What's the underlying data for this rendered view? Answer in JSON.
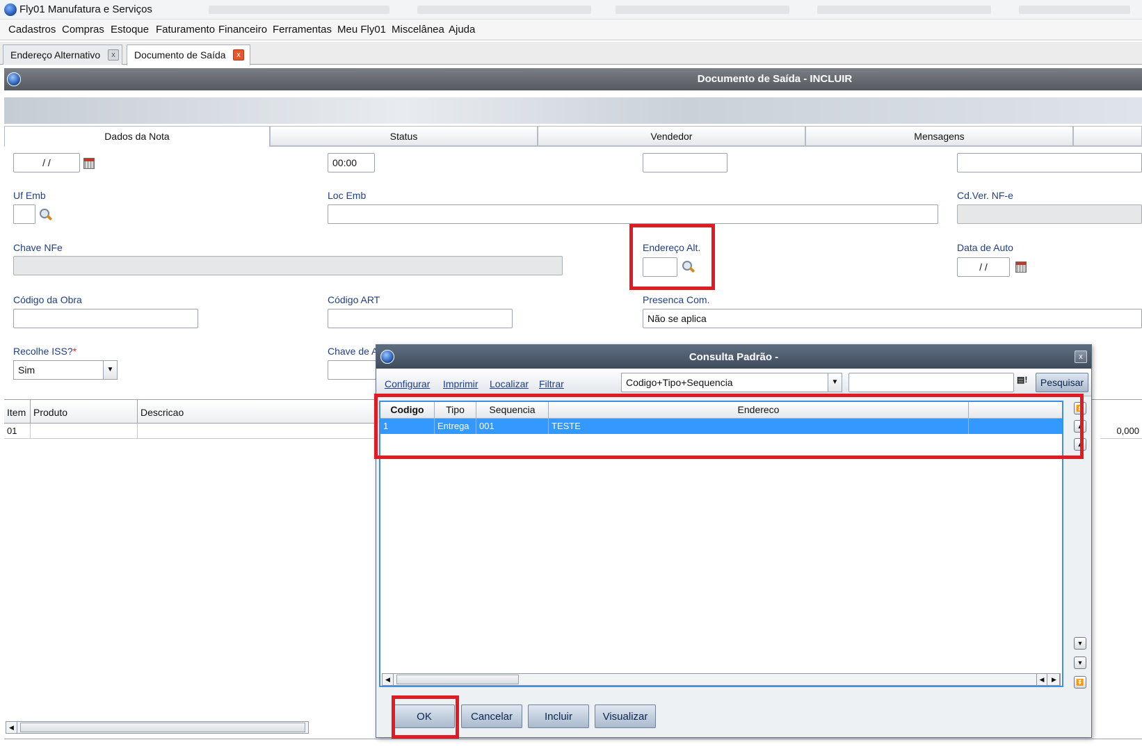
{
  "window": {
    "app_title": "Fly01 Manufatura e Serviços"
  },
  "menu": [
    "Cadastros",
    "Compras",
    "Estoque",
    "Faturamento",
    "Financeiro",
    "Ferramentas",
    "Meu Fly01",
    "Miscelânea",
    "Ajuda"
  ],
  "tabs": [
    {
      "label": "Endereço Alternativo",
      "close": "x"
    },
    {
      "label": "Documento de Saída",
      "close": "x"
    }
  ],
  "form": {
    "title": "Documento de Saída - INCLUIR",
    "tabs": [
      "Dados da Nota",
      "Status",
      "Vendedor",
      "Mensagens"
    ],
    "fields": {
      "date_value": "/ /",
      "time_value": "00:00",
      "uf_emb_label": "Uf Emb",
      "loc_emb_label": "Loc Emb",
      "cd_ver_label": "Cd.Ver. NF-e",
      "chave_nfe_label": "Chave NFe",
      "endereco_alt_label": "Endereço Alt.",
      "data_auto_label": "Data de Auto",
      "data_auto_value": "/ /",
      "codigo_obra_label": "Código da Obra",
      "codigo_art_label": "Código ART",
      "presenca_label": "Presenca Com.",
      "presenca_value": "Não se aplica",
      "recolhe_iss_label": "Recolhe ISS?",
      "recolhe_iss_req": "*",
      "recolhe_iss_value": "Sim",
      "chave_de_label": "Chave de A"
    },
    "items_grid": {
      "headers": [
        "Item",
        "Produto",
        "Descricao"
      ],
      "row": {
        "item": "01",
        "value": "0,000"
      }
    }
  },
  "dialog": {
    "title": "Consulta Padrão -",
    "close": "x",
    "links": [
      "Configurar",
      "Imprimir",
      "Localizar",
      "Filtrar"
    ],
    "order_select": "Codigo+Tipo+Sequencia",
    "search_button": "Pesquisar",
    "headers": [
      "Codigo",
      "Tipo",
      "Sequencia",
      "Endereco"
    ],
    "rows": [
      {
        "codigo": "1",
        "tipo": "Entrega",
        "sequencia": "001",
        "endereco": "TESTE"
      }
    ],
    "buttons": [
      "OK",
      "Cancelar",
      "Incluir",
      "Visualizar"
    ]
  },
  "colors": {
    "highlight_red": "#e01b24",
    "selection_blue": "#3399ff",
    "label_blue": "#1f3f86"
  }
}
